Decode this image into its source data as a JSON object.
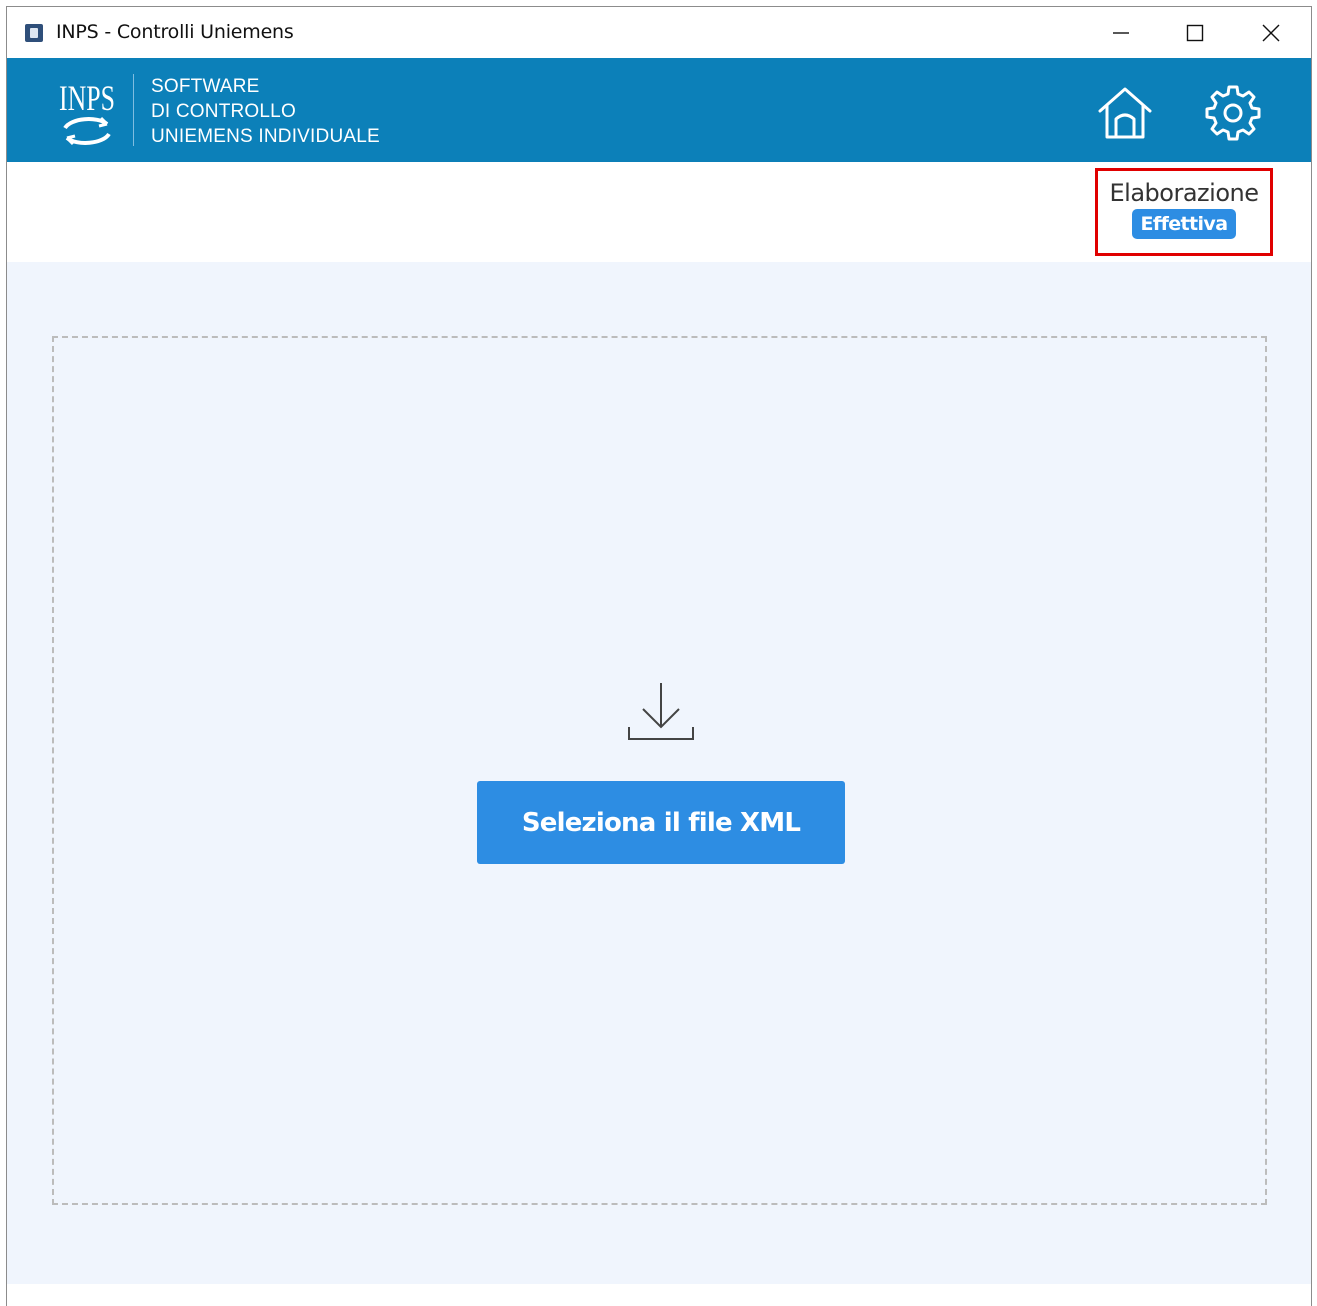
{
  "window": {
    "title": "INPS - Controlli Uniemens",
    "icon": "app-icon",
    "controls": [
      "minimize-icon",
      "maximize-icon",
      "close-icon"
    ]
  },
  "header": {
    "logo": "inps-logo",
    "tagline": {
      "line1": "SOFTWARE",
      "line2": "DI CONTROLLO",
      "line3": "UNIEMENS INDIVIDUALE"
    },
    "icons": [
      "home-icon",
      "gear-icon"
    ],
    "background_color": "#0c80b9"
  },
  "mode": {
    "label": "Elaborazione",
    "badge": "Effettiva",
    "badge_color": "#2d8de3",
    "highlight_color": "#e00000"
  },
  "dropzone": {
    "icon": "download-icon",
    "button_label": "Seleziona il file XML",
    "button_color": "#2d8de3",
    "background_color": "#f0f5fd"
  }
}
